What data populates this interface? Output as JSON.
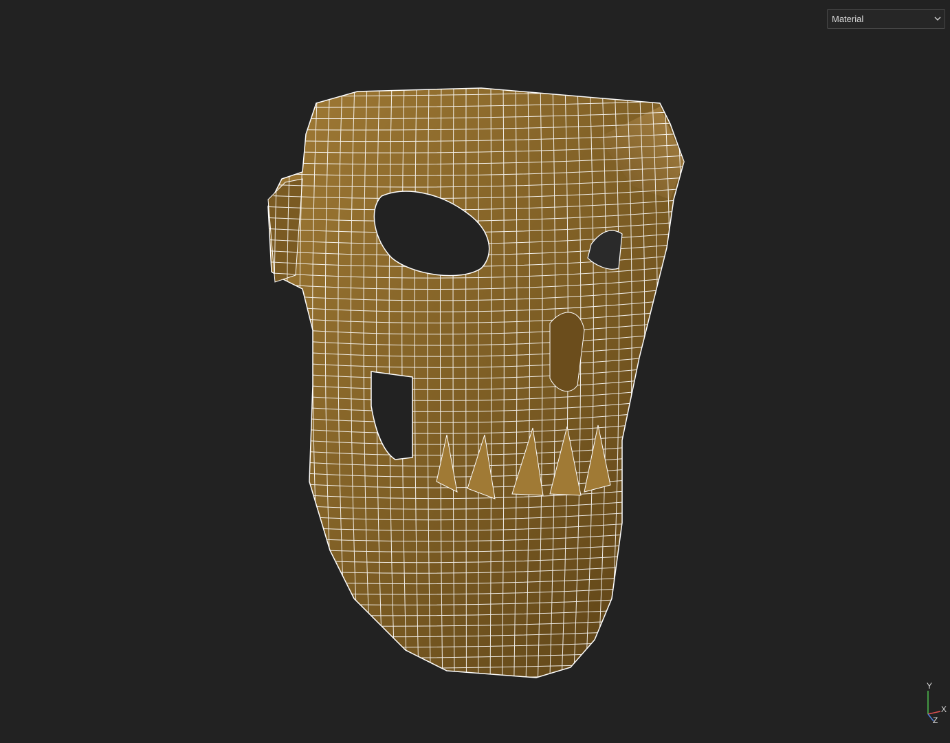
{
  "viewport": {
    "background": "#222222",
    "mode_select": {
      "value": "Material"
    },
    "model": {
      "kind": "skull mask wireframe over material shading",
      "material_color": "#8a6a2c",
      "wire_color": "#ffffff"
    },
    "axis_gizmo": {
      "x_label": "X",
      "y_label": "Y",
      "z_label": "Z",
      "x_color": "#e05050",
      "y_color": "#50c050",
      "z_color": "#5080e0"
    }
  }
}
